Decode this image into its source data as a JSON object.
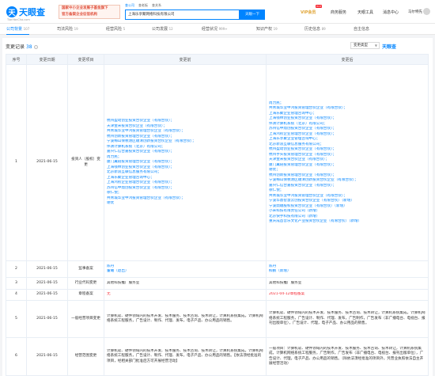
{
  "header": {
    "logo_mark": "天",
    "logo_name": "天眼查",
    "logo_sub": "TianYanCha.com",
    "banner_line1": "国家中小企业发展子基金旗下",
    "banner_line2": "官方备案企业征信机构",
    "search_tabs": [
      "查公司",
      "查老板",
      "查关系"
    ],
    "search_value": "上海乐享聚网络科技有限公司",
    "search_button": "天眼一下",
    "nav": {
      "vip": "VIP会员",
      "hot_badge": "HOT",
      "product": "商务服务",
      "tools": "天眼工具",
      "messages": "消息中心",
      "user": "马尔特先"
    }
  },
  "tabs": [
    {
      "label": "公司背景",
      "count": "107"
    },
    {
      "label": "司法风险",
      "count": "19"
    },
    {
      "label": "经营风险",
      "count": "5"
    },
    {
      "label": "公司发展",
      "count": "12"
    },
    {
      "label": "经营状况",
      "count": "999+"
    },
    {
      "label": "知识产权",
      "count": "19"
    },
    {
      "label": "历史信息",
      "count": "89"
    },
    {
      "label": "自主信息",
      "count": ""
    }
  ],
  "section": {
    "title": "变更记录",
    "count": "38",
    "filter_label": "变更类型",
    "watermark": "天眼查"
  },
  "columns": [
    "序号",
    "变更日期",
    "变更项目",
    "变更前",
    "变更后"
  ],
  "rows": [
    {
      "index": "1",
      "date": "2021-06-15",
      "item": "投资人（股权）变更",
      "before": [
        "杭州盈动创业投资合伙企业（有限合伙）；",
        "天津金米投资合伙企业（有限合伙）；",
        "共青城华业中鸿投资管理合伙企业（有限合伙）；",
        "杭州创新投资管理合伙企业（有限合伙）；",
        "宁波梅山保税港区顺清创新投资合伙企业（有限合伙）；",
        "伟清计算机系统（北京）有限公司；",
        "嘉兴仁信合嘉投资合伙企业（有限合伙）；",
        "周力民；",
        "厦门翼链投资管理合伙企业（有限合伙）；",
        "上海钱林创业投资合伙企业（有限合伙）；",
        "北京新浪互联信息服务有限公司；",
        "上海乐聚企业管理咨询中心；",
        "上海鸿初企业管理合伙企业（有限合伙）；",
        "苏州信中鼎创投资合伙企业（有限合伙）；",
        "徐仁悦；",
        "共青城华业中鸿投资管理合伙企业（有限合伙）；",
        "谢优"
      ],
      "after": [
        "周力民；",
        "共青城华业中鸿投资管理合伙企业（有限合伙）；",
        "上海乐聚企业管理咨询中心；",
        "上海钱林创业投资合伙企业（有限合伙）；",
        "伟清计算机系统（北京）有限公司；",
        "苏州信中鼎创投资合伙企业（有限合伙）；",
        "上海鸿初企业管理合伙企业（有限合伙）；",
        "上海乐享聚企业管理咨询中心；",
        "北京新浪互联信息服务有限公司；",
        "杭州盈动创业投资合伙企业（有限合伙）；",
        "杭州手头投资管理合伙企业（有限合伙）；",
        "天津金米投资合伙企业（有限合伙）；",
        "厦门翼链投资管理合伙企业（有限合伙）；",
        "谢优；",
        "杭州创新投资管理合伙企业（有限合伙）；",
        "宁波梅山保税港区顺清创新投资合伙企业（有限合伙）；",
        "嘉兴仁信合嘉投资合伙企业（有限合伙）；",
        "徐仁悦；",
        "共青城华业中鸿投资管理合伙企业（有限合伙）；",
        "宁波华鼎智慧云创投资合伙企业（有限合伙）（新增）",
        "宁波鼎顺股权投资合伙企业（有限合伙）（新增）",
        "小米科技有限责任公司（新增）",
        "北京快手科技有限公司（新增）",
        "重庆成首音乐文化产业投资合伙企业（有限合伙）（新增）"
      ],
      "after_new_start": 19
    },
    {
      "index": "2",
      "date": "2021-06-15",
      "item": "监事备案",
      "before": [
        "陈丹",
        "董曦（退出）"
      ],
      "after": [
        "陈丹",
        "柳鹏（新增）"
      ]
    },
    {
      "index": "3",
      "date": "2021-06-15",
      "item": "行业代码变更",
      "before": [
        "其他科技推广服务业"
      ],
      "after": [
        "其他科技推广服务业"
      ]
    },
    {
      "index": "4",
      "date": "2021-06-15",
      "item": "章程备案",
      "before": [
        "无"
      ],
      "after": [
        "2021-04-12章程备案"
      ]
    },
    {
      "index": "5",
      "date": "2021-06-15",
      "item": "一般经营项目变更",
      "before": [
        "计算机软、硬件领域内的技术开发、技术服务、技术咨询、技术转让，计算机系统集成，计算机网络系统工程服务，广告设计、制作、代理、发布，电子产品、办公用品的销售。"
      ],
      "after": [
        "计算机软、硬件领域内的技术开发、技术服务、技术咨询、技术转让，计算机系统集成，计算机网络系统工程服务，广告设计、制作、代理、发布，广告制作，广告发布（非广播电台、电视台、报刊出版单位），广告设计、代理，电子产品、办公用品的销售。"
      ]
    },
    {
      "index": "6",
      "date": "2021-06-15",
      "item": "经营范围变更",
      "before": [
        "计算机软、硬件领域内的技术开发、技术服务、技术咨询、技术转让，计算机系统集成，计算机网络系统工程服务，广告设计、制作、代理、发布，电子产品、办公用品的销售。【依法须经批准的项目，经相关部门批准后方可开展经营活动】"
      ],
      "after": [
        "一般项目：计算机软、硬件领域内的技术开发、技术服务、技术咨询、技术转让，计算机系统集成，计算机网络系统工程服务，广告制作，广告发布（非广播电台、电视台、报刊出版单位），广告设计、代理，电子产品、办公用品的销售。（除依法须经批准的项目外，凭营业执照依法自主开展经营活动）"
      ]
    }
  ]
}
